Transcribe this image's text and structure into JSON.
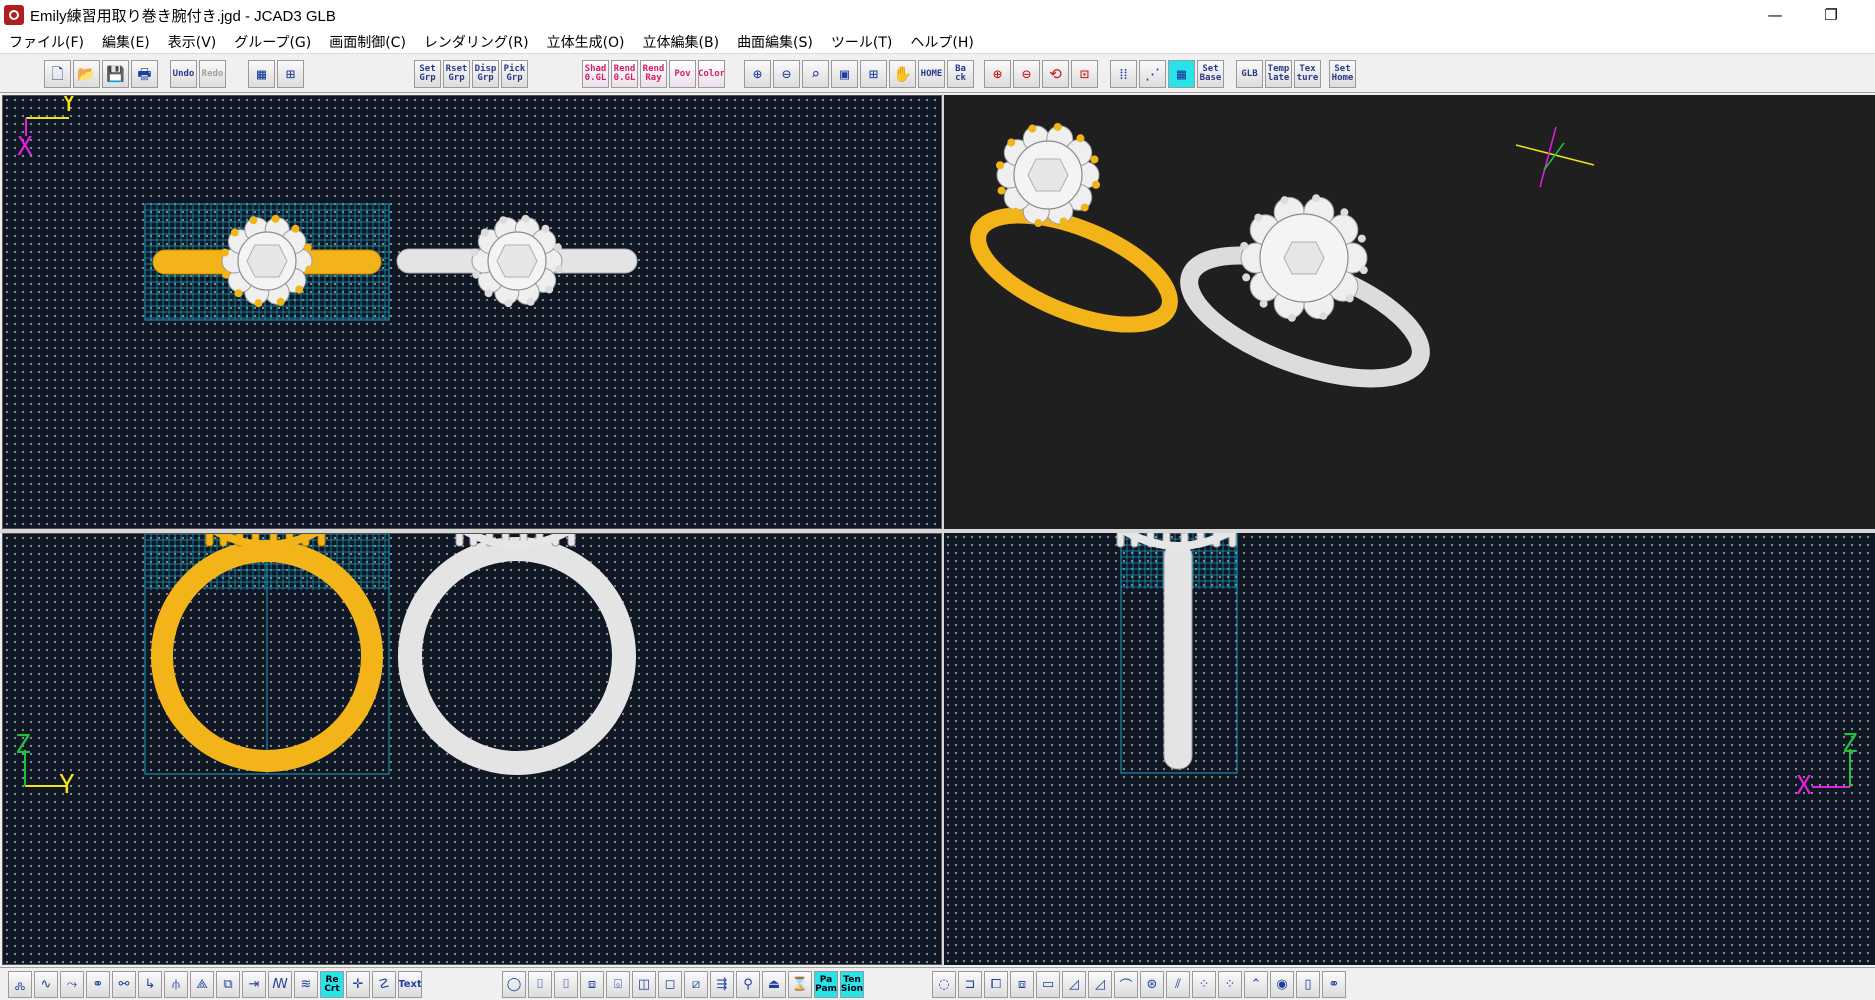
{
  "window": {
    "title": "Emily練習用取り巻き腕付き.jgd - JCAD3 GLB",
    "minimize_glyph": "—",
    "restore_glyph": "❐"
  },
  "menu": [
    "ファイル(F)",
    "編集(E)",
    "表示(V)",
    "グループ(G)",
    "画面制御(C)",
    "レンダリング(R)",
    "立体生成(O)",
    "立体編集(B)",
    "曲面編集(S)",
    "ツール(T)",
    "ヘルプ(H)"
  ],
  "toolbar": {
    "file_group": [
      {
        "name": "new-file-icon",
        "glyph": "🗋"
      },
      {
        "name": "open-file-icon",
        "glyph": "📂"
      },
      {
        "name": "save-icon",
        "glyph": "💾"
      },
      {
        "name": "print-icon",
        "glyph": "🖶"
      }
    ],
    "undo_label": "Undo",
    "redo_label": "Redo",
    "group_buttons": [
      "Set Grp",
      "Rset Grp",
      "Disp Grp",
      "Pick Grp"
    ],
    "render_buttons": [
      "Shad 0.GL",
      "Rend 0.GL",
      "Rend Ray",
      "Pov",
      "Color"
    ],
    "view_group": [
      {
        "name": "zoom-in-icon",
        "glyph": "⊕"
      },
      {
        "name": "zoom-out-icon",
        "glyph": "⊖"
      },
      {
        "name": "zoom-window-icon",
        "glyph": "⌕"
      },
      {
        "name": "zoom-all-icon",
        "glyph": "▣"
      },
      {
        "name": "zoom-fit-icon",
        "glyph": "⊞"
      },
      {
        "name": "pan-hand-icon",
        "glyph": "✋"
      }
    ],
    "home_label": "HOME",
    "back_label": "Ba ck",
    "rotate_group": [
      {
        "name": "rotate-plus-icon",
        "glyph": "⊕"
      },
      {
        "name": "rotate-minus-icon",
        "glyph": "⊖"
      },
      {
        "name": "rotate-free-icon",
        "glyph": "⟲"
      },
      {
        "name": "view-frame-icon",
        "glyph": "⊡"
      }
    ],
    "grid_group": [
      {
        "name": "grid-dots-icon",
        "glyph": "⁞⁞"
      },
      {
        "name": "grid-snap-icon",
        "glyph": "⋰"
      },
      {
        "name": "grid-fine-icon",
        "glyph": "▦"
      }
    ],
    "set_base_label": "Set Base",
    "glb_label": "GLB",
    "template_label": "Temp late",
    "texture_label": "Tex ture",
    "set_home_label": "Set Home"
  },
  "viewports": {
    "top": {
      "axis_h": "Y",
      "axis_v": "X"
    },
    "front": {
      "axis_h": "Y",
      "axis_v": "Z"
    },
    "side": {
      "axis_h": "X",
      "axis_v": "Z"
    }
  },
  "colors": {
    "viewport_bg": "#0f1724",
    "perspective_bg": "#1f1f1f",
    "gold": "#f2b418",
    "silver": "#e4e4e4",
    "selection_grid": "#1aa3c4",
    "axis_yellow": "#f0e020",
    "axis_magenta": "#e020e0",
    "axis_green": "#20c040"
  },
  "bottom_toolbar": {
    "left": [
      "🝆",
      "∿",
      "⤳",
      "⚭",
      "⚯",
      "↳",
      "⫛",
      "⟁",
      "⧉",
      "⇥",
      "ꟿ",
      "≋",
      "Re Crt",
      "✛",
      "☡",
      "Text"
    ],
    "middle": [
      "◯",
      "⌷",
      "⌷",
      "⧈",
      "⌺",
      "◫",
      "◻",
      "⧄",
      "⇶",
      "⚲",
      "⏏",
      "⌛",
      "Pa Pam",
      "Ten Sion"
    ],
    "right": [
      "◌",
      "⊐",
      "⧠",
      "⧈",
      "▭",
      "◿",
      "◿",
      "⌒",
      "⊛",
      "⫽",
      "⁘",
      "⁘",
      "⌃",
      "◉",
      "▯",
      "⚭"
    ]
  }
}
